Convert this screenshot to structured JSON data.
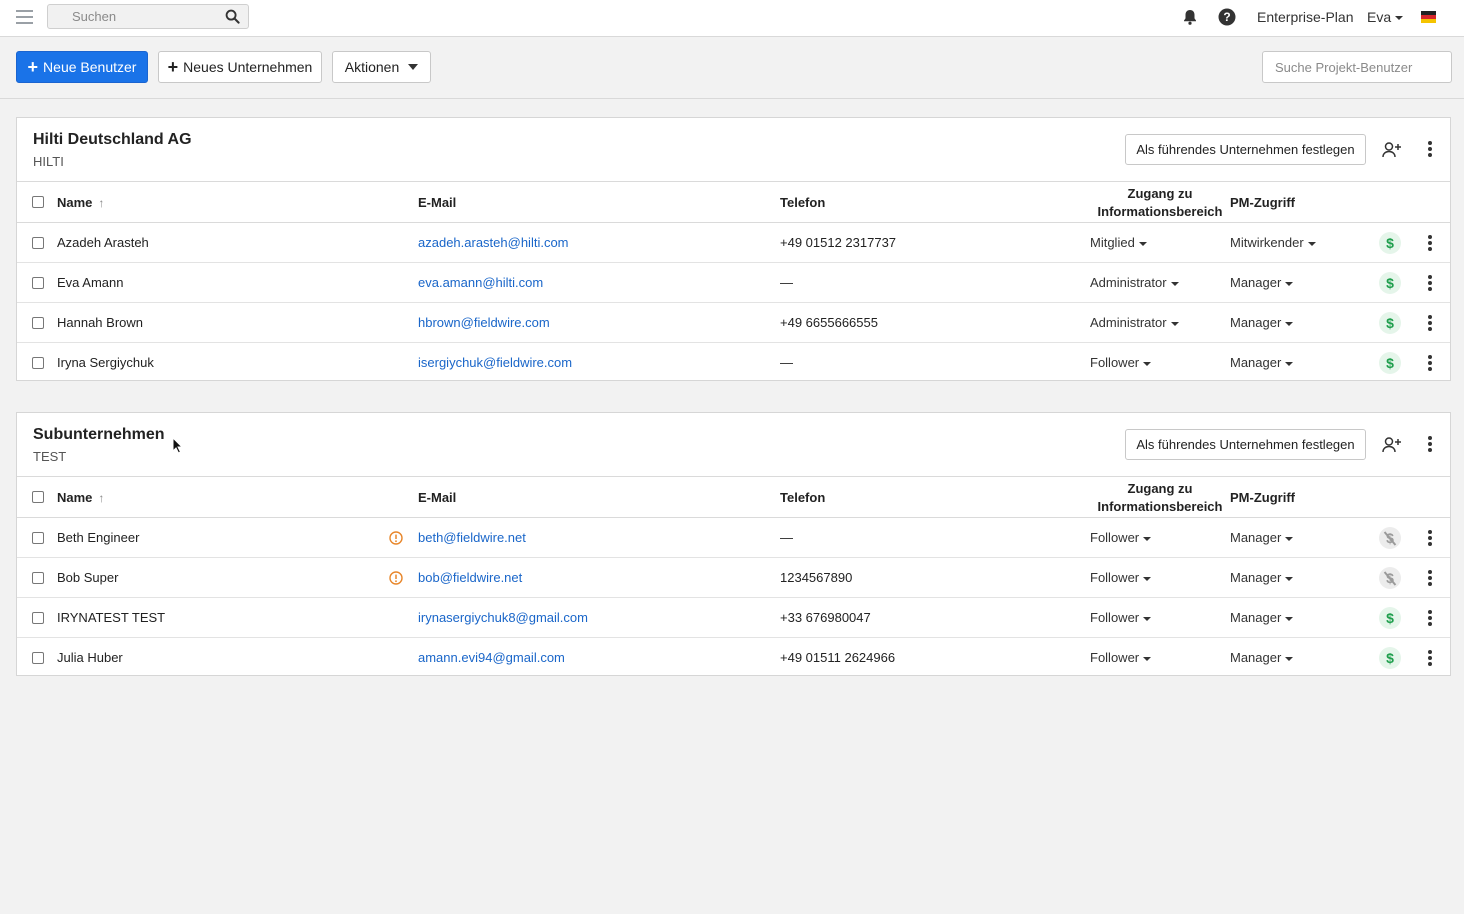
{
  "topbar": {
    "search_placeholder": "Suchen",
    "plan_label": "Enterprise-Plan",
    "user_label": "Eva"
  },
  "toolbar": {
    "new_user_label": "Neue Benutzer",
    "new_company_label": "Neues Unternehmen",
    "actions_label": "Aktionen",
    "project_search_placeholder": "Suche Projekt-Benutzer"
  },
  "columns": {
    "name": "Name",
    "email": "E-Mail",
    "phone": "Telefon",
    "access_line1": "Zugang zu",
    "access_line2": "Informationsbereich",
    "pm": "PM-Zugriff"
  },
  "lead_button_label": "Als führendes Unternehmen festlegen",
  "companies": [
    {
      "name": "Hilti Deutschland AG",
      "code": "HILTI",
      "rows": [
        {
          "name": "Azadeh Arasteh",
          "email": "azadeh.arasteh@hilti.com",
          "phone": "+49 01512 2317737",
          "access": "Mitglied",
          "pm": "Mitwirkender",
          "paid": true,
          "warning": false
        },
        {
          "name": "Eva Amann",
          "email": "eva.amann@hilti.com",
          "phone": "—",
          "access": "Administrator",
          "pm": "Manager",
          "paid": true,
          "warning": false
        },
        {
          "name": "Hannah Brown",
          "email": "hbrown@fieldwire.com",
          "phone": "+49 6655666555",
          "access": "Administrator",
          "pm": "Manager",
          "paid": true,
          "warning": false
        },
        {
          "name": "Iryna Sergiychuk",
          "email": "isergiychuk@fieldwire.com",
          "phone": "—",
          "access": "Follower",
          "pm": "Manager",
          "paid": true,
          "warning": false
        }
      ]
    },
    {
      "name": "Subunternehmen",
      "code": "TEST",
      "rows": [
        {
          "name": "Beth Engineer",
          "email": "beth@fieldwire.net",
          "phone": "—",
          "access": "Follower",
          "pm": "Manager",
          "paid": false,
          "warning": true
        },
        {
          "name": "Bob Super",
          "email": "bob@fieldwire.net",
          "phone": "1234567890",
          "access": "Follower",
          "pm": "Manager",
          "paid": false,
          "warning": true
        },
        {
          "name": "IRYNATEST TEST",
          "email": "irynasergiychuk8@gmail.com",
          "phone": "+33 676980047",
          "access": "Follower",
          "pm": "Manager",
          "paid": true,
          "warning": false
        },
        {
          "name": "Julia Huber",
          "email": "amann.evi94@gmail.com",
          "phone": "+49 01511 2624966",
          "access": "Follower",
          "pm": "Manager",
          "paid": true,
          "warning": false
        }
      ]
    }
  ],
  "icons": {
    "paid": "$",
    "sort": "↑"
  },
  "colors": {
    "primary": "#1a73e8",
    "link": "#1a66c9",
    "paid_green": "#1e9e4c",
    "warning_orange": "#e8862a"
  }
}
